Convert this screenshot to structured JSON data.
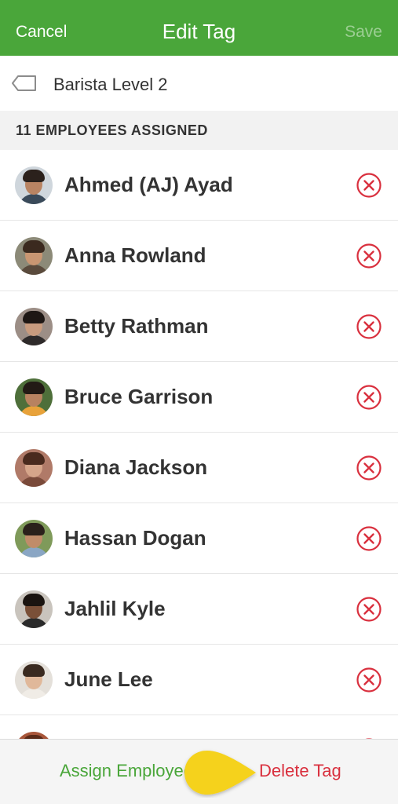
{
  "header": {
    "cancel_label": "Cancel",
    "title": "Edit Tag",
    "save_label": "Save"
  },
  "tag": {
    "name": "Barista Level 2",
    "icon": "tag-icon"
  },
  "section": {
    "label": "11 EMPLOYEES ASSIGNED"
  },
  "employees": [
    {
      "name": "Ahmed (AJ) Ayad"
    },
    {
      "name": "Anna Rowland"
    },
    {
      "name": "Betty Rathman"
    },
    {
      "name": "Bruce Garrison"
    },
    {
      "name": "Diana Jackson"
    },
    {
      "name": "Hassan Dogan"
    },
    {
      "name": "Jahlil Kyle"
    },
    {
      "name": "June Lee"
    },
    {
      "name": ""
    }
  ],
  "footer": {
    "assign_label": "Assign Employees",
    "delete_label": "Delete Tag"
  },
  "colors": {
    "brand_green": "#4aa63a",
    "remove_red": "#d9303e",
    "callout_yellow": "#f5d21f"
  },
  "icons": {
    "remove": "remove-circle-x-icon",
    "callout": "pointer-callout-icon"
  }
}
